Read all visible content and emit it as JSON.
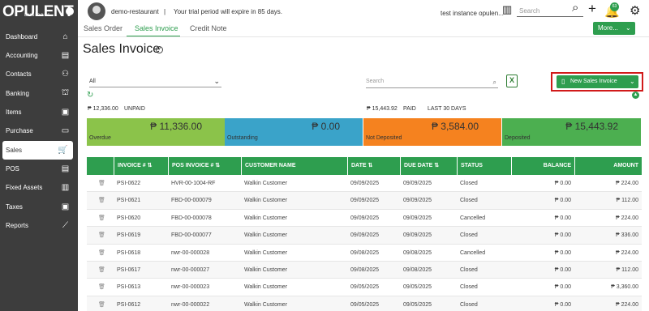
{
  "brand": {
    "logo_text": "OPULENT",
    "logo_sub": "Business"
  },
  "sidebar": {
    "items": [
      {
        "label": "Dashboard",
        "icon": "home-icon",
        "glyph": "⌂"
      },
      {
        "label": "Accounting",
        "icon": "ledger-icon",
        "glyph": "▤"
      },
      {
        "label": "Contacts",
        "icon": "add-person-icon",
        "glyph": "⚇"
      },
      {
        "label": "Banking",
        "icon": "bank-icon",
        "glyph": "⛫"
      },
      {
        "label": "Items",
        "icon": "box-icon",
        "glyph": "▣"
      },
      {
        "label": "Purchase",
        "icon": "card-icon",
        "glyph": "▭"
      },
      {
        "label": "Sales",
        "icon": "cart-icon",
        "glyph": "🛒"
      },
      {
        "label": "POS",
        "icon": "receipt-icon",
        "glyph": "▤"
      },
      {
        "label": "Fixed Assets",
        "icon": "building-icon",
        "glyph": "▥"
      },
      {
        "label": "Taxes",
        "icon": "wallet-icon",
        "glyph": "▣"
      },
      {
        "label": "Reports",
        "icon": "chart-icon",
        "glyph": "⟋"
      }
    ],
    "active": "Sales"
  },
  "topbar": {
    "user": "demo-restaurant",
    "separator": "|",
    "trial_text": "Your trial period will expire in 85 days.",
    "instance": "test instance opulen...",
    "search_placeholder": "Search",
    "notif_count": "63"
  },
  "tabs": [
    {
      "label": "Sales Order"
    },
    {
      "label": "Sales Invoice"
    },
    {
      "label": "Credit Note"
    }
  ],
  "more_button": {
    "label": "More...",
    "chev": "⌄"
  },
  "page": {
    "title": "Sales Invoice",
    "info_glyph": "?"
  },
  "filters": {
    "select_value": "All",
    "search_placeholder": "Search",
    "new_button_label": "New Sales Invoice"
  },
  "summary": {
    "unpaid_amount": "₱ 12,336.00",
    "unpaid_label": "UNPAID",
    "paid_amount": "₱ 15,443.92",
    "paid_label": "PAID",
    "period_label": "LAST 30 DAYS"
  },
  "cards": [
    {
      "amount": "₱ 11,336.00",
      "label": "Overdue",
      "color": "#8bc34a"
    },
    {
      "amount": "₱ 0.00",
      "label": "Outstanding",
      "color": "#3aa3c9"
    },
    {
      "amount": "₱ 3,584.00",
      "label": "Not Deposited",
      "color": "#f5821f"
    },
    {
      "amount": "₱ 15,443.92",
      "label": "Deposited",
      "color": "#4caf50"
    }
  ],
  "table": {
    "headers": [
      "INVOICE # ⇅",
      "POS INVOICE # ⇅",
      "CUSTOMER NAME",
      "DATE ⇅",
      "DUE DATE ⇅",
      "STATUS",
      "BALANCE",
      "AMOUNT"
    ],
    "rows": [
      {
        "invoice": "PSI-0622",
        "pos": "HVR-00-1004-RF",
        "customer": "Walkin Customer",
        "date": "09/09/2025",
        "due": "09/09/2025",
        "status": "Closed",
        "balance": "₱ 0.00",
        "amount": "₱ 224.00"
      },
      {
        "invoice": "PSI-0621",
        "pos": "FBD-00-000079",
        "customer": "Walkin Customer",
        "date": "09/09/2025",
        "due": "09/09/2025",
        "status": "Closed",
        "balance": "₱ 0.00",
        "amount": "₱ 112.00"
      },
      {
        "invoice": "PSI-0620",
        "pos": "FBD-00-000078",
        "customer": "Walkin Customer",
        "date": "09/09/2025",
        "due": "09/09/2025",
        "status": "Cancelled",
        "balance": "₱ 0.00",
        "amount": "₱ 224.00"
      },
      {
        "invoice": "PSI-0619",
        "pos": "FBD-00-000077",
        "customer": "Walkin Customer",
        "date": "09/09/2025",
        "due": "09/09/2025",
        "status": "Closed",
        "balance": "₱ 0.00",
        "amount": "₱ 336.00"
      },
      {
        "invoice": "PSI-0618",
        "pos": "nwr-00-000028",
        "customer": "Walkin Customer",
        "date": "09/08/2025",
        "due": "09/08/2025",
        "status": "Cancelled",
        "balance": "₱ 0.00",
        "amount": "₱ 224.00"
      },
      {
        "invoice": "PSI-0617",
        "pos": "nwr-00-000027",
        "customer": "Walkin Customer",
        "date": "09/08/2025",
        "due": "09/08/2025",
        "status": "Closed",
        "balance": "₱ 0.00",
        "amount": "₱ 112.00"
      },
      {
        "invoice": "PSI-0613",
        "pos": "nwr-00-000023",
        "customer": "Walkin Customer",
        "date": "09/05/2025",
        "due": "09/05/2025",
        "status": "Closed",
        "balance": "₱ 0.00",
        "amount": "₱ 3,360.00"
      },
      {
        "invoice": "PSI-0612",
        "pos": "nwr-00-000022",
        "customer": "Walkin Customer",
        "date": "09/05/2025",
        "due": "09/05/2025",
        "status": "Closed",
        "balance": "₱ 0.00",
        "amount": "₱ 224.00"
      }
    ]
  }
}
